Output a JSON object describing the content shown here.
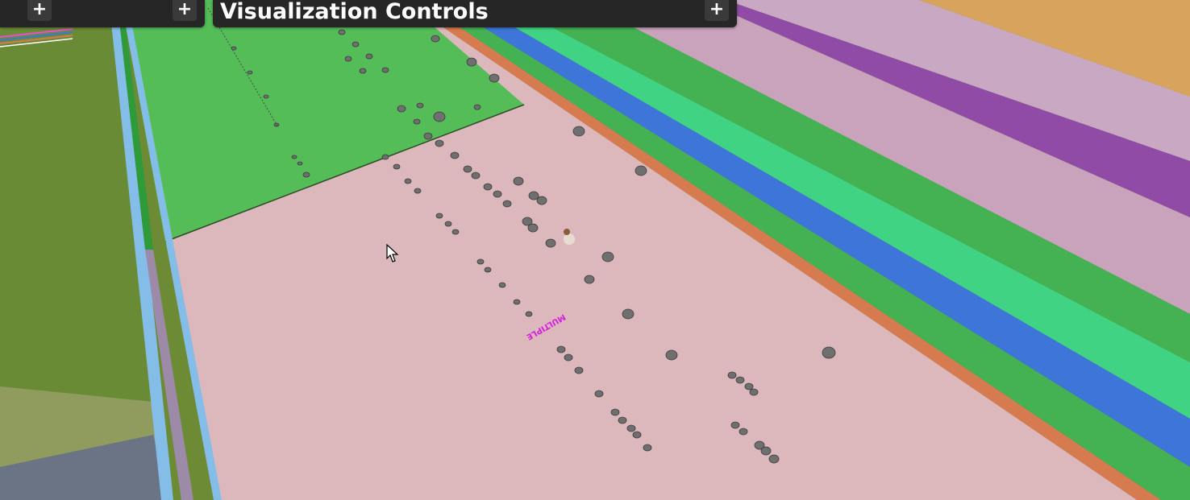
{
  "panels": {
    "left": {
      "add_label": "+",
      "add_label_2": "+"
    },
    "main": {
      "title": "Visualization Controls",
      "add_label": "+"
    }
  },
  "world": {
    "tag_label": "MULTIPLE"
  },
  "colors": {
    "panel_bg": "#262626",
    "panel_button": "#3a3a3a",
    "pink_floor": "#dcb8bc",
    "green_floor": "#54bd58",
    "orange_stripe": "#d67a4f",
    "blue_stripe": "#3d76d8",
    "mint_stripe": "#3fd383",
    "purple_stripe": "#8f4ba5",
    "light_purple_stripe": "#c9a8c4",
    "tan_corner": "#d8a35c",
    "grass": "#6d8a35",
    "label_magenta": "#d51ee0"
  }
}
